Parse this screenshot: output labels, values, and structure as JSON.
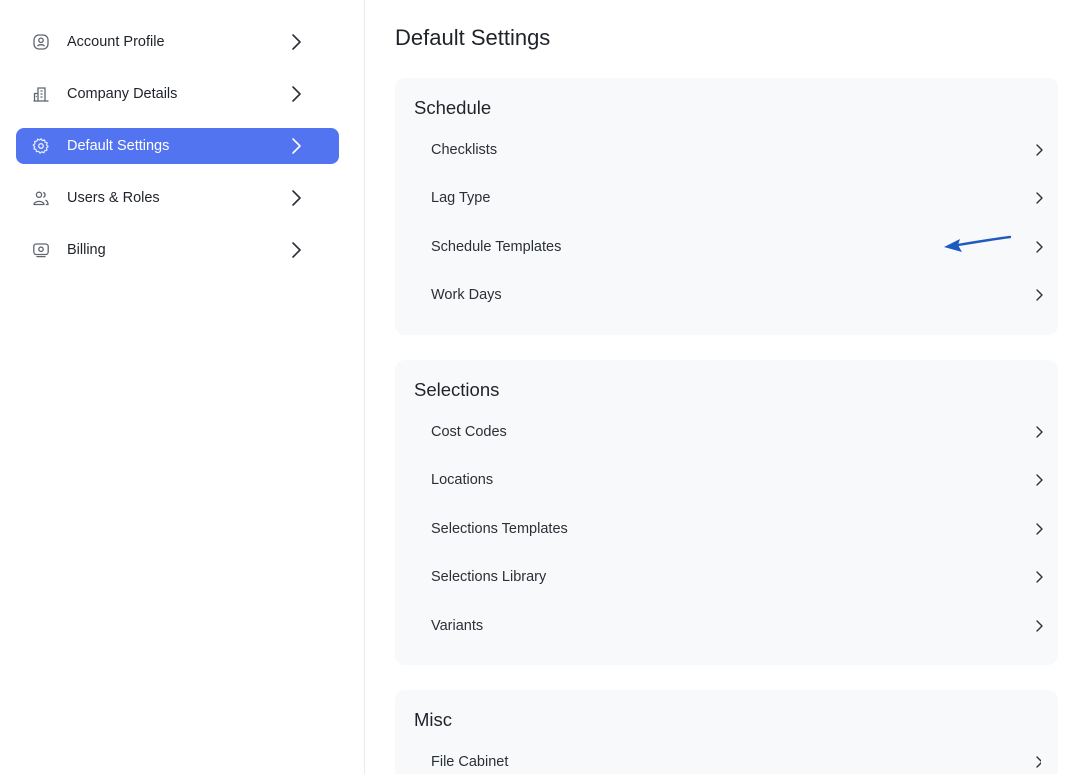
{
  "sidebar": {
    "items": [
      {
        "label": "Account Profile",
        "icon": "user-circle-icon",
        "active": false
      },
      {
        "label": "Company Details",
        "icon": "building-icon",
        "active": false
      },
      {
        "label": "Default Settings",
        "icon": "gear-icon",
        "active": true
      },
      {
        "label": "Users & Roles",
        "icon": "users-icon",
        "active": false
      },
      {
        "label": "Billing",
        "icon": "money-icon",
        "active": false
      }
    ]
  },
  "main": {
    "title": "Default Settings",
    "sections": [
      {
        "title": "Schedule",
        "items": [
          "Checklists",
          "Lag Type",
          "Schedule Templates",
          "Work Days"
        ]
      },
      {
        "title": "Selections",
        "items": [
          "Cost Codes",
          "Locations",
          "Selections Templates",
          "Selections Library",
          "Variants"
        ]
      },
      {
        "title": "Misc",
        "items": [
          "File Cabinet"
        ]
      }
    ]
  },
  "colors": {
    "accent": "#5274f1",
    "card_background": "#f8f9fb",
    "annotation_arrow": "#1f5bbf"
  }
}
